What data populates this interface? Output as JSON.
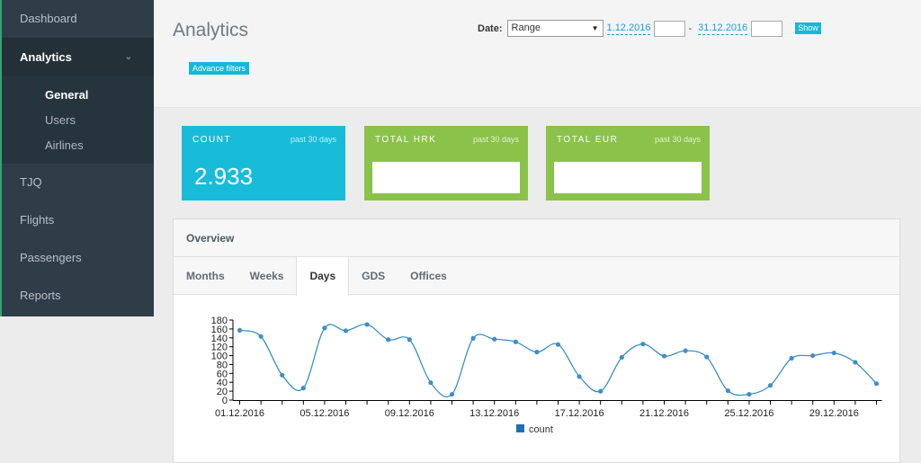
{
  "sidebar": {
    "items": [
      {
        "label": "Dashboard"
      },
      {
        "label": "Analytics",
        "active": true,
        "subitems": [
          {
            "label": "General",
            "active": true
          },
          {
            "label": "Users"
          },
          {
            "label": "Airlines"
          }
        ]
      },
      {
        "label": "TJQ"
      },
      {
        "label": "Flights"
      },
      {
        "label": "Passengers"
      },
      {
        "label": "Reports"
      }
    ]
  },
  "header": {
    "title": "Analytics",
    "advanced_filters_label": "Advance filters",
    "date_label": "Date:",
    "range_select_value": "Range",
    "date_from": "1.12.2016",
    "date_separator": "-",
    "date_to": "31.12.2016",
    "show_label": "Show"
  },
  "cards": {
    "count": {
      "title": "COUNT",
      "period": "past 30 days",
      "value": "2.933"
    },
    "total_hrk": {
      "title": "TOTAL HRK",
      "period": "past 30 days"
    },
    "total_eur": {
      "title": "TOTAL EUR",
      "period": "past 30 days"
    }
  },
  "overview": {
    "title": "Overview",
    "tabs": [
      {
        "label": "Months"
      },
      {
        "label": "Weeks"
      },
      {
        "label": "Days",
        "active": true
      },
      {
        "label": "GDS"
      },
      {
        "label": "Offices"
      }
    ]
  },
  "colors": {
    "sidebar_bg": "#2e3d48",
    "accent_cyan": "#18bcd9",
    "accent_green": "#8bc34a",
    "series_line": "#3d8fc6",
    "series_legend": "#1f6fb2"
  },
  "chart_data": {
    "type": "line",
    "x_tick_labels": [
      "01.12.2016",
      "05.12.2016",
      "09.12.2016",
      "13.12.2016",
      "17.12.2016",
      "21.12.2016",
      "25.12.2016",
      "29.12.2016"
    ],
    "y_tick_labels": [
      "0",
      "20",
      "40",
      "60",
      "80",
      "100",
      "120",
      "140",
      "160",
      "180"
    ],
    "ylim": [
      0,
      180
    ],
    "x": [
      "01.12.2016",
      "02.12.2016",
      "03.12.2016",
      "04.12.2016",
      "05.12.2016",
      "06.12.2016",
      "07.12.2016",
      "08.12.2016",
      "09.12.2016",
      "10.12.2016",
      "11.12.2016",
      "12.12.2016",
      "13.12.2016",
      "14.12.2016",
      "15.12.2016",
      "16.12.2016",
      "17.12.2016",
      "18.12.2016",
      "19.12.2016",
      "20.12.2016",
      "21.12.2016",
      "22.12.2016",
      "23.12.2016",
      "24.12.2016",
      "25.12.2016",
      "26.12.2016",
      "27.12.2016",
      "28.12.2016",
      "29.12.2016",
      "30.12.2016",
      "31.12.2016"
    ],
    "series": [
      {
        "name": "count",
        "values": [
          157,
          143,
          56,
          27,
          162,
          156,
          170,
          136,
          136,
          39,
          13,
          139,
          137,
          131,
          108,
          125,
          53,
          20,
          96,
          126,
          99,
          111,
          97,
          21,
          13,
          33,
          94,
          100,
          106,
          85,
          37
        ]
      }
    ],
    "grid": false,
    "legend": "bottom-center"
  }
}
